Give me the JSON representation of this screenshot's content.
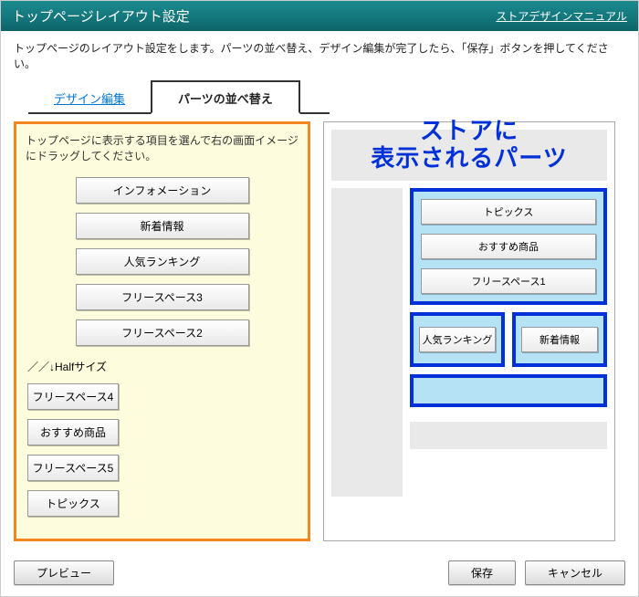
{
  "header": {
    "title": "トップページレイアウト設定",
    "manual_link": "ストアデザインマニュアル"
  },
  "intro": "トップページのレイアウト設定をします。パーツの並べ替え、デザイン編集が完了したら、「保存」ボタンを押してください。",
  "tabs": {
    "design": "デザイン編集",
    "rearrange": "パーツの並べ替え"
  },
  "left": {
    "instruction": "トップページに表示する項目を選んで右の画面イメージにドラッグしてください。",
    "full": [
      "インフォメーション",
      "新着情報",
      "人気ランキング",
      "フリースペース3",
      "フリースペース2"
    ],
    "half_label": "／／↓Halfサイズ",
    "half": [
      "フリースペース4",
      "おすすめ商品",
      "フリースペース5",
      "トピックス"
    ]
  },
  "overlay": {
    "line1": "ストアに",
    "line2": "表示されるパーツ"
  },
  "preview": {
    "full_zone": [
      "トピックス",
      "おすすめ商品",
      "フリースペース1"
    ],
    "half_left": "人気ランキング",
    "half_right": "新着情報"
  },
  "footer": {
    "preview": "プレビュー",
    "save": "保存",
    "cancel": "キャンセル"
  }
}
